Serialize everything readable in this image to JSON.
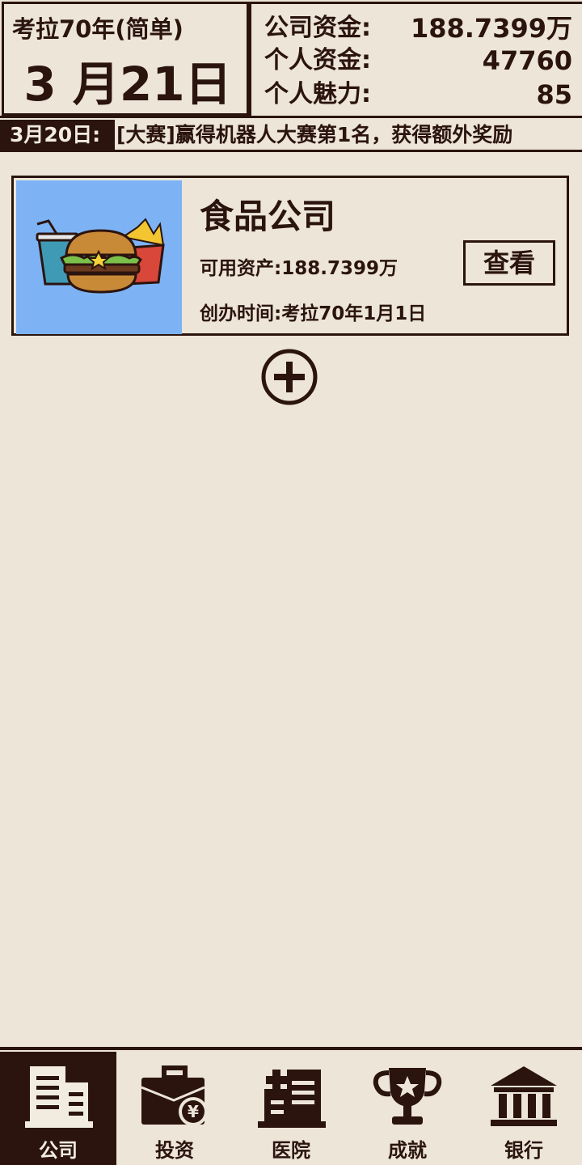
{
  "header": {
    "year_label": "考拉70年(简单)",
    "big_date": "3 月21日",
    "stats": [
      {
        "label": "公司资金:",
        "value": "188.7399万"
      },
      {
        "label": "个人资金:",
        "value": "47760"
      },
      {
        "label": "个人魅力:",
        "value": "85"
      }
    ]
  },
  "ticker": {
    "date": "3月20日:",
    "text": "[大赛]赢得机器人大赛第1名，获得额外奖励"
  },
  "company": {
    "name": "食品公司",
    "assets": "可用资产:188.7399万",
    "founded": "创办时间:考拉70年1月1日",
    "view_label": "查看",
    "thumb_icon": "burger-fries-drink-icon"
  },
  "add_icon": "plus-circle-icon",
  "tabs": [
    {
      "label": "公司",
      "icon": "building-icon",
      "active": true
    },
    {
      "label": "投资",
      "icon": "briefcase-yen-icon",
      "active": false
    },
    {
      "label": "医院",
      "icon": "hospital-icon",
      "active": false
    },
    {
      "label": "成就",
      "icon": "trophy-icon",
      "active": false
    },
    {
      "label": "银行",
      "icon": "bank-icon",
      "active": false
    }
  ],
  "colors": {
    "ink": "#2b140e",
    "paper": "#ece5d8",
    "thumb_bg": "#7db3f5"
  }
}
